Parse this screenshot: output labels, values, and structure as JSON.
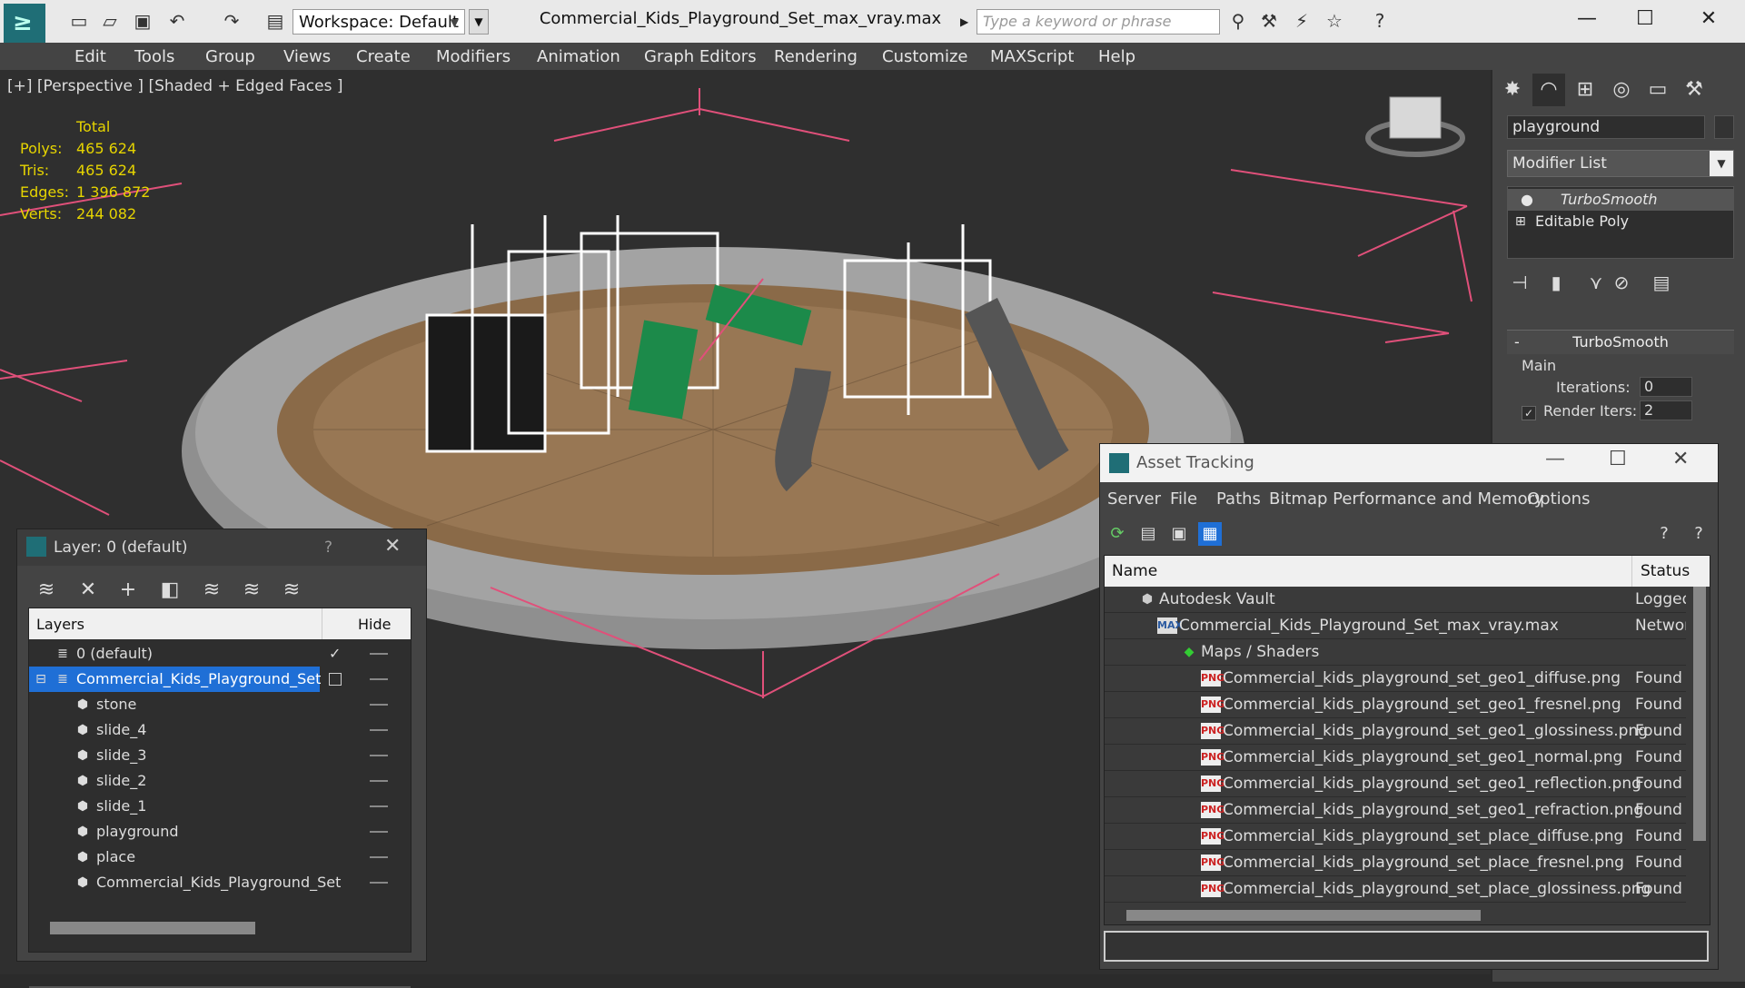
{
  "titlebar": {
    "workspace_label": "Workspace: Default",
    "document_title": "Commercial_Kids_Playground_Set_max_vray.max",
    "search_placeholder": "Type a keyword or phrase"
  },
  "menu": [
    "Edit",
    "Tools",
    "Group",
    "Views",
    "Create",
    "Modifiers",
    "Animation",
    "Graph Editors",
    "Rendering",
    "Customize",
    "MAXScript",
    "Help"
  ],
  "viewport": {
    "label": "[+] [Perspective ] [Shaded + Edged Faces ]",
    "stats": {
      "header": "Total",
      "polys_label": "Polys:",
      "polys": "465 624",
      "tris_label": "Tris:",
      "tris": "465 624",
      "edges_label": "Edges:",
      "edges": "1 396 872",
      "verts_label": "Verts:",
      "verts": "244 082"
    }
  },
  "command_panel": {
    "object_name": "playground",
    "modifier_list": "Modifier List",
    "stack": [
      "TurboSmooth",
      "Editable Poly"
    ],
    "rollout_title": "TurboSmooth",
    "group_main": "Main",
    "iterations_label": "Iterations:",
    "iterations_value": "0",
    "render_iters_label": "Render Iters:",
    "render_iters_value": "2"
  },
  "layer_dialog": {
    "title": "Layer: 0 (default)",
    "help": "?",
    "col_layers": "Layers",
    "col_hide": "Hide",
    "rows": [
      {
        "label": "0 (default)"
      },
      {
        "label": "Commercial_Kids_Playground_Set"
      },
      {
        "label": "stone"
      },
      {
        "label": "slide_4"
      },
      {
        "label": "slide_3"
      },
      {
        "label": "slide_2"
      },
      {
        "label": "slide_1"
      },
      {
        "label": "playground"
      },
      {
        "label": "place"
      },
      {
        "label": "Commercial_Kids_Playground_Set"
      }
    ]
  },
  "asset_dialog": {
    "title": "Asset Tracking",
    "menu": [
      "Server",
      "File",
      "Paths",
      "Bitmap Performance and Memory",
      "Options"
    ],
    "col_name": "Name",
    "col_status": "Status",
    "rows": [
      {
        "name": "Autodesk Vault",
        "status": "Logged"
      },
      {
        "name": "Commercial_Kids_Playground_Set_max_vray.max",
        "status": "Networ"
      },
      {
        "name": "Maps / Shaders",
        "status": ""
      },
      {
        "name": "Commercial_kids_playground_set_geo1_diffuse.png",
        "status": "Found"
      },
      {
        "name": "Commercial_kids_playground_set_geo1_fresnel.png",
        "status": "Found"
      },
      {
        "name": "Commercial_kids_playground_set_geo1_glossiness.png",
        "status": "Found"
      },
      {
        "name": "Commercial_kids_playground_set_geo1_normal.png",
        "status": "Found"
      },
      {
        "name": "Commercial_kids_playground_set_geo1_reflection.png",
        "status": "Found"
      },
      {
        "name": "Commercial_kids_playground_set_geo1_refraction.png",
        "status": "Found"
      },
      {
        "name": "Commercial_kids_playground_set_place_diffuse.png",
        "status": "Found"
      },
      {
        "name": "Commercial_kids_playground_set_place_fresnel.png",
        "status": "Found"
      },
      {
        "name": "Commercial_kids_playground_set_place_glossiness.png",
        "status": "Found"
      }
    ],
    "png_badge": "PNG",
    "max_badge": "MAX"
  },
  "colors": {
    "accent_blue": "#1f6fd6",
    "yellow_stats": "#e6d400",
    "gizmo_pink": "#e0507a"
  }
}
